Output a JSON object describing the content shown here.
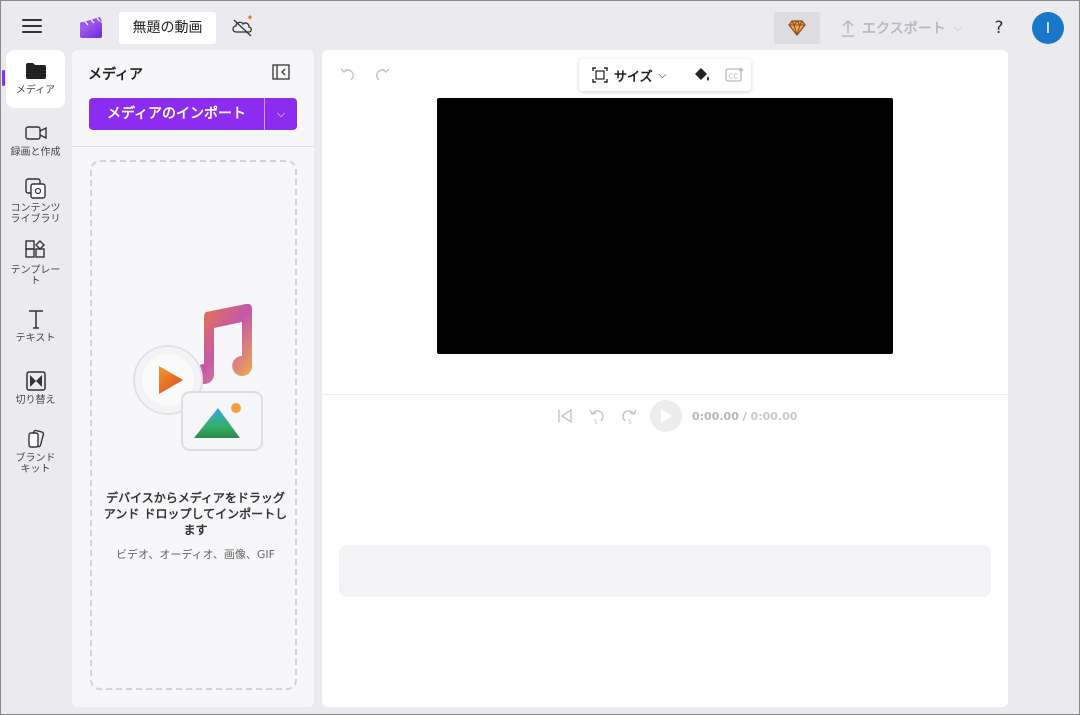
{
  "header": {
    "project_title": "無題の動画",
    "export_label": "エクスポート",
    "help_label": "?",
    "avatar_initial": "I"
  },
  "rail": {
    "items": [
      {
        "label": "メディア",
        "icon": "folder-icon",
        "active": true
      },
      {
        "label": "録画と作成",
        "icon": "video-camera-icon"
      },
      {
        "label": "コンテンツ\nライブラリ",
        "icon": "content-library-icon"
      },
      {
        "label": "テンプレー\nト",
        "icon": "templates-icon"
      },
      {
        "label": "テキスト",
        "icon": "text-icon"
      },
      {
        "label": "切り替え",
        "icon": "transitions-icon"
      },
      {
        "label": "ブランド\nキット",
        "icon": "brand-kit-icon"
      }
    ]
  },
  "media_panel": {
    "title": "メディア",
    "import_label": "メディアのインポート",
    "drop_text": "デバイスからメディアをドラッグ アンド ドロップしてインポートします",
    "drop_sub": "ビデオ、オーディオ、画像、GIF"
  },
  "editor": {
    "size_label": "サイズ",
    "time_current": "0:00.00",
    "time_separator": " / ",
    "time_total": "0:00.00",
    "canvas_color": "#000000"
  },
  "colors": {
    "accent": "#8b2cf0",
    "avatar": "#1877c9"
  }
}
